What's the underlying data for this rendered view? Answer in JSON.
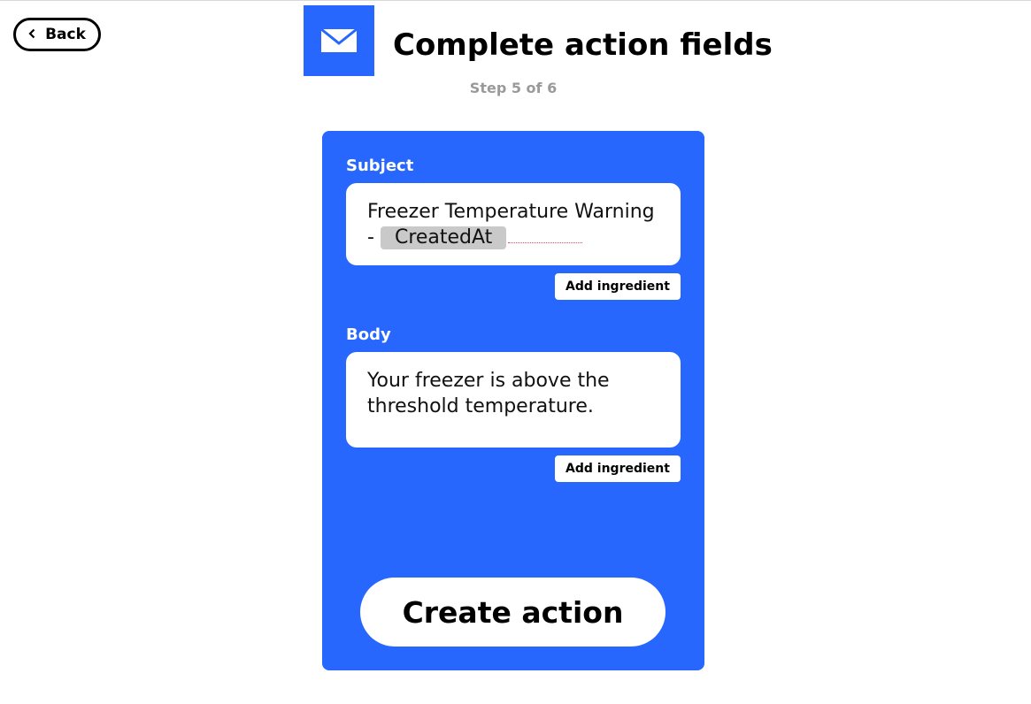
{
  "header": {
    "back_label": "Back",
    "title": "Complete action fields",
    "step": "Step 5 of 6",
    "service_icon": "envelope-icon",
    "service_color": "#2767fe"
  },
  "form": {
    "subject": {
      "label": "Subject",
      "text_before": "Freezer Temperature Warning",
      "separator": "-",
      "ingredient": "CreatedAt",
      "add_ingredient_label": "Add ingredient"
    },
    "body": {
      "label": "Body",
      "text": "Your freezer is above the threshold temperature.",
      "add_ingredient_label": "Add ingredient"
    },
    "submit_label": "Create action"
  }
}
